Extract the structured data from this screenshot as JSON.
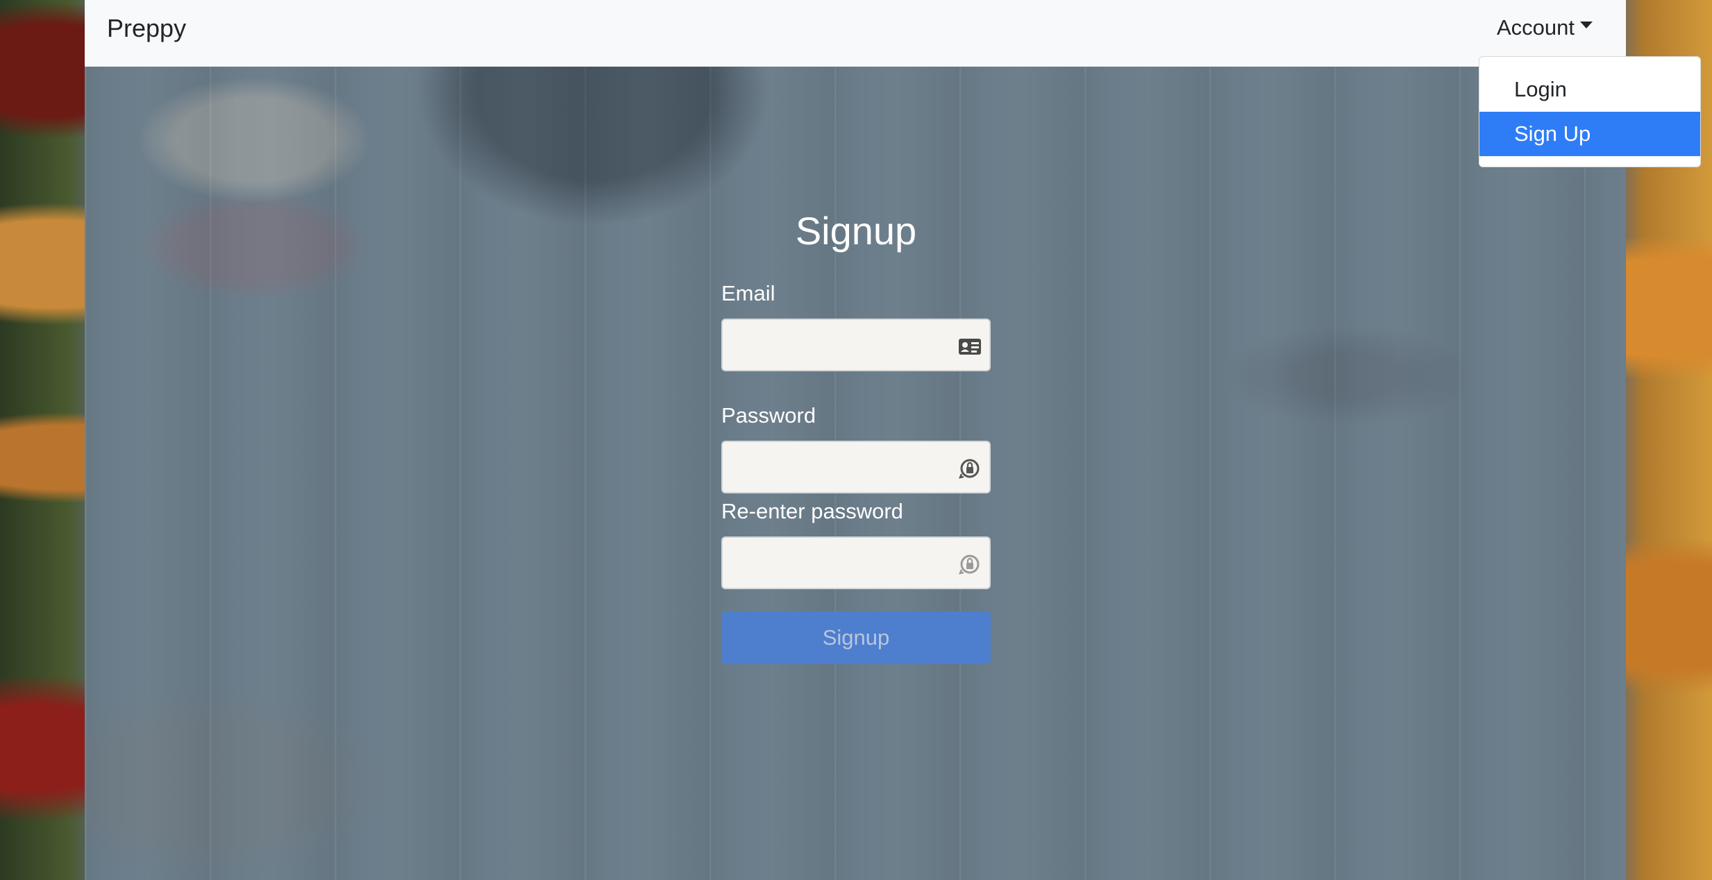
{
  "navbar": {
    "brand": "Preppy",
    "account_label": "Account"
  },
  "account_menu": {
    "items": [
      {
        "label": "Login",
        "active": false
      },
      {
        "label": "Sign Up",
        "active": true
      }
    ]
  },
  "form": {
    "title": "Signup",
    "email_label": "Email",
    "email_value": "",
    "password_label": "Password",
    "password_value": "",
    "reenter_label": "Re-enter password",
    "reenter_value": "",
    "submit_label": "Signup"
  },
  "icons": {
    "email": "id-card-icon",
    "password": "lock-rotate-icon",
    "reenter": "lock-rotate-icon"
  },
  "colors": {
    "accent": "#2f7df6",
    "button": "#4e7fce",
    "navbar_bg": "#f8f9fa"
  }
}
